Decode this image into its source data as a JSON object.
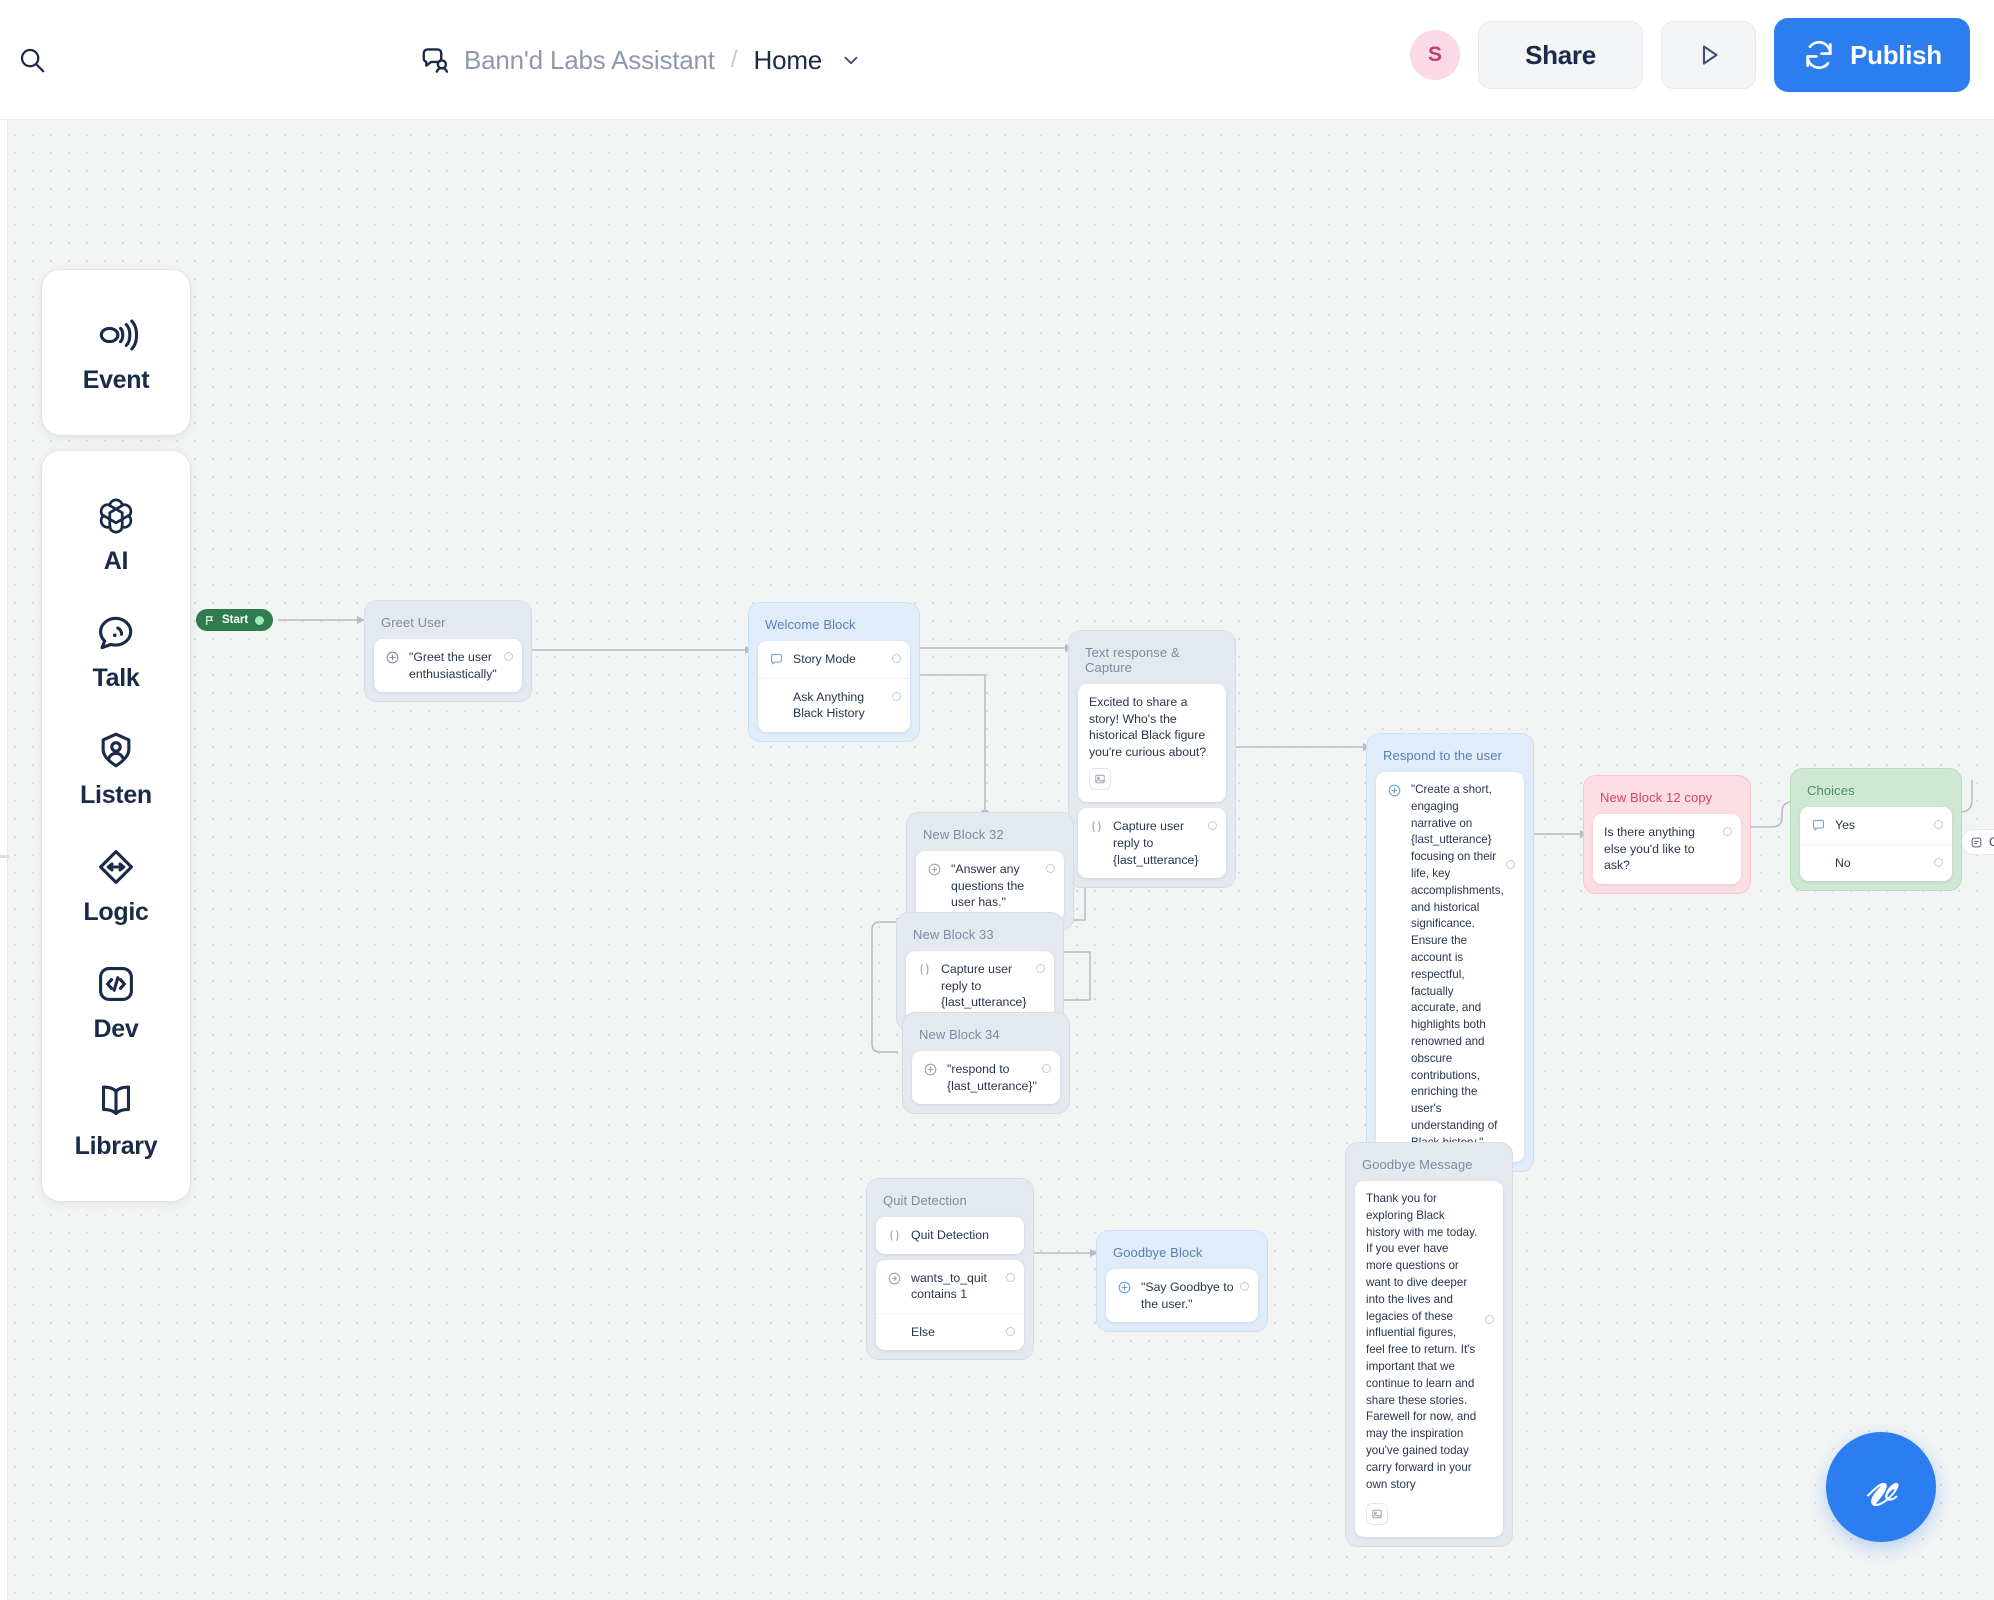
{
  "header": {
    "search_icon": "search-icon",
    "project_icon": "project-avatar-icon",
    "project_name": "Bann'd Labs Assistant",
    "separator": "/",
    "current_page": "Home",
    "caret_icon": "chevron-down-icon",
    "avatar_initial": "S",
    "share_label": "Share",
    "run_icon": "play-icon",
    "publish_label": "Publish",
    "publish_icon": "refresh-icon",
    "accent_color": "#2b7df0",
    "avatar_bg": "#fbd9e6",
    "avatar_fg": "#c2406d"
  },
  "sidebar": {
    "groups": [
      {
        "items": [
          {
            "label": "Event",
            "icon": "event-broadcast-icon"
          }
        ]
      },
      {
        "items": [
          {
            "label": "AI",
            "icon": "openai-logo-icon"
          },
          {
            "label": "Talk",
            "icon": "speech-bubble-icon"
          },
          {
            "label": "Listen",
            "icon": "user-listen-icon"
          },
          {
            "label": "Logic",
            "icon": "logic-arrows-icon"
          },
          {
            "label": "Dev",
            "icon": "code-brackets-icon"
          },
          {
            "label": "Library",
            "icon": "book-open-icon"
          }
        ]
      }
    ]
  },
  "canvas": {
    "start_chip": {
      "label": "Start",
      "icon": "flag-icon",
      "status_dot": true,
      "color": "#2f7d4e"
    },
    "offscreen_chip": {
      "label": "Go",
      "icon": "flow-icon"
    },
    "vf_button": {
      "icon": "voiceflow-logo-icon"
    },
    "blocks": [
      {
        "id": "greet-user",
        "title": "Greet User",
        "theme": "grey",
        "rows": [
          {
            "icon": "ai-sparkle-icon",
            "text": "\"Greet the user enthusiastically\"",
            "port": true
          }
        ]
      },
      {
        "id": "welcome-block",
        "title": "Welcome Block",
        "theme": "blue",
        "rows": [
          {
            "icon": "capture-bubble-icon",
            "text": "Story Mode",
            "port": true
          },
          {
            "icon": "",
            "text": "Ask Anything Black History",
            "port": true
          }
        ]
      },
      {
        "id": "text-response-capture",
        "title": "Text response & Capture",
        "theme": "grey",
        "rows": [
          {
            "icon": "",
            "text": "Excited to share a story! Who's the historical Black figure you're curious about?",
            "attach": true,
            "port": false
          },
          {
            "icon": "variable-icon",
            "text": "Capture user reply to {last_utterance}",
            "port": true
          }
        ]
      },
      {
        "id": "respond-to-the-user",
        "title": "Respond to the user",
        "theme": "blue",
        "rows": [
          {
            "icon": "ai-sparkle-icon",
            "text": "\"Create a short, engaging narrative on {last_utterance} focusing on their life, key accomplishments, and historical significance. Ensure the account is respectful, factually accurate, and highlights both renowned and obscure contributions, enriching the user's understanding of Black history.\"",
            "port": true
          }
        ]
      },
      {
        "id": "new-block-12-copy",
        "title": "New Block 12 copy",
        "theme": "red",
        "rows": [
          {
            "icon": "",
            "text": "Is there anything else you'd like to ask?",
            "port": true
          }
        ]
      },
      {
        "id": "choices",
        "title": "Choices",
        "theme": "green",
        "rows": [
          {
            "icon": "capture-bubble-icon",
            "text": "Yes",
            "port": true
          },
          {
            "icon": "",
            "text": "No",
            "port": true
          }
        ]
      },
      {
        "id": "new-block-32",
        "title": "New Block 32",
        "theme": "grey",
        "rows": [
          {
            "icon": "ai-sparkle-icon",
            "text": "\"Answer any questions the user has.\"",
            "port": true
          }
        ]
      },
      {
        "id": "new-block-33",
        "title": "New Block 33",
        "theme": "grey",
        "rows": [
          {
            "icon": "variable-icon",
            "text": "Capture user reply to {last_utterance}",
            "port": true
          }
        ]
      },
      {
        "id": "new-block-34",
        "title": "New Block 34",
        "theme": "grey",
        "rows": [
          {
            "icon": "ai-sparkle-icon",
            "text": "\"respond to {last_utterance}\"",
            "port": true
          }
        ]
      },
      {
        "id": "quit-detection",
        "title": "Quit Detection",
        "theme": "grey",
        "rows": [
          {
            "icon": "condition-icon",
            "text": "Quit Detection",
            "port": false
          },
          {
            "icon": "logic-small-icon",
            "text": "wants_to_quit contains 1",
            "port": true
          },
          {
            "icon": "",
            "text": "Else",
            "port": true
          }
        ]
      },
      {
        "id": "goodbye-block",
        "title": "Goodbye Block",
        "theme": "blue",
        "rows": [
          {
            "icon": "ai-sparkle-icon",
            "text": "\"Say Goodbye to the user.\"",
            "port": true
          }
        ]
      },
      {
        "id": "goodbye-message",
        "title": "Goodbye Message",
        "theme": "grey",
        "rows": [
          {
            "icon": "",
            "text": "Thank you for exploring Black history with me today. If you ever have more questions or want to dive deeper into the lives and legacies of these influential figures, feel free to return. It's important that we continue to learn and share these stories. Farewell for now, and may the inspiration you've gained today carry forward in your own story",
            "attach": true,
            "port": true
          }
        ]
      }
    ]
  }
}
